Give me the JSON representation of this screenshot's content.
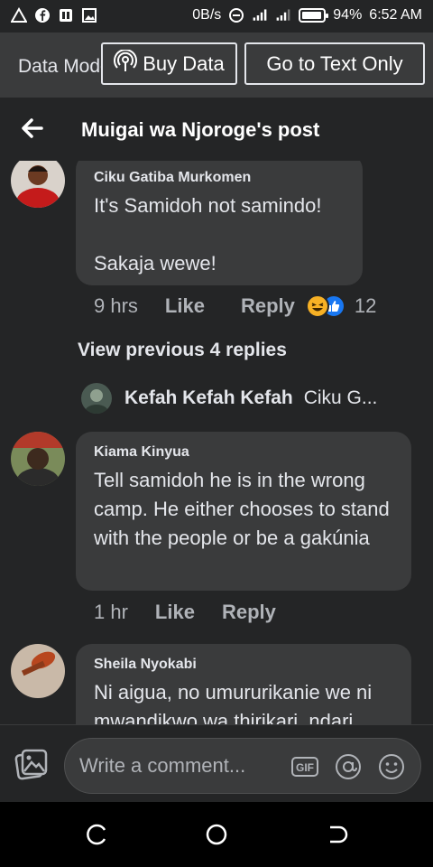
{
  "status_bar": {
    "icons_left": [
      "warning-triangle-icon",
      "facebook-icon",
      "pdf-icon",
      "image-icon"
    ],
    "data_speed": "0B/s",
    "battery_percent": "94%",
    "battery_level": 0.94,
    "time": "6:52 AM"
  },
  "data_mode": {
    "label": "Data Mode",
    "buy_data": "Buy Data",
    "text_only": "Go to Text Only"
  },
  "header": {
    "title": "Muigai wa Njoroge's post"
  },
  "comments": [
    {
      "author": "Ciku Gatiba Murkomen",
      "text": "It's Samidoh not samindo!\n\nSakaja wewe!",
      "time": "9 hrs",
      "like": "Like",
      "reply": "Reply",
      "reaction_count": "12"
    },
    {
      "author": "Kiama Kinyua",
      "text": "Tell samidoh he is in the wrong camp. He either chooses to stand with the people or be a gakúnia",
      "time": "1 hr",
      "like": "Like",
      "reply": "Reply"
    },
    {
      "author": "Sheila Nyokabi",
      "text": "Ni aigua, no umururikanie we ni mwandikwo wa thirikari, ndari"
    }
  ],
  "view_previous": "View previous 4 replies",
  "reply_preview": {
    "author": "Kefah Kefah Kefah",
    "snippet": "Ciku G..."
  },
  "composer": {
    "placeholder": "Write a comment..."
  },
  "colors": {
    "background": "#242526",
    "bubble": "#3a3b3c",
    "text": "#e4e6eb",
    "muted": "#b0b3b8",
    "like_blue": "#1877f2",
    "haha_yellow": "#f7b125"
  }
}
